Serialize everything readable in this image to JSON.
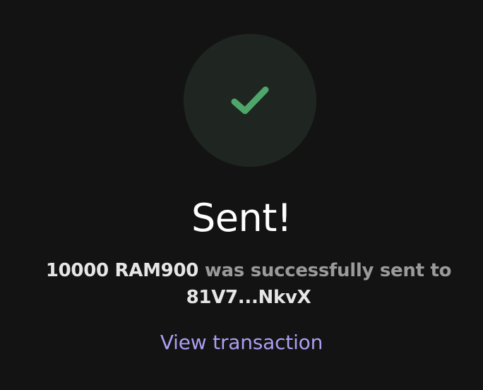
{
  "status": {
    "icon": "checkmark-icon",
    "icon_color": "#4fa66b",
    "circle_color": "#1f2621"
  },
  "title": "Sent!",
  "message": {
    "amount": "10000 RAM900",
    "text": "was successfully sent to",
    "recipient": "81V7...NkvX"
  },
  "view_transaction_label": "View transaction",
  "colors": {
    "background": "#131313",
    "link": "#ab9ff2"
  }
}
